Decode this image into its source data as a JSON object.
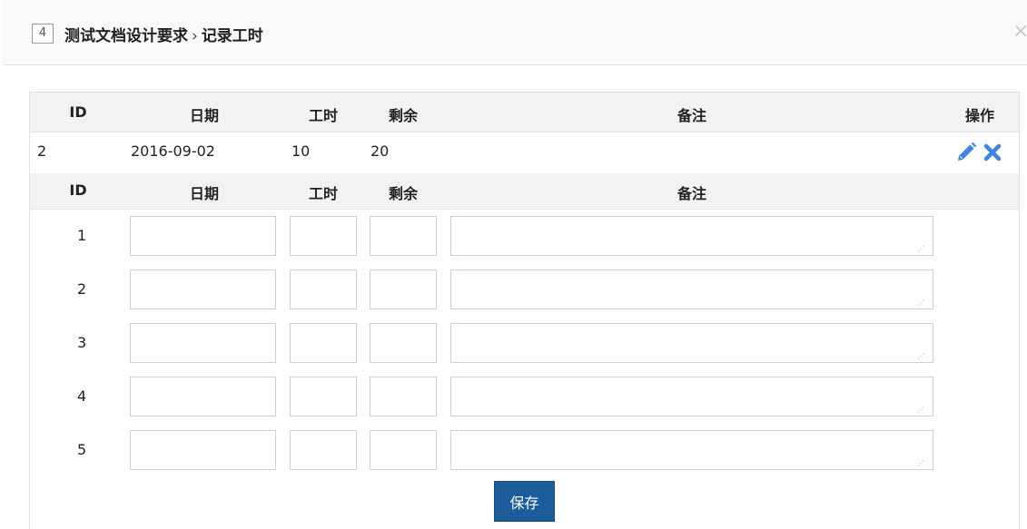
{
  "modal": {
    "id_badge": "4",
    "title_part1": "测试文档设计要求",
    "separator": "›",
    "title_part2": "记录工时",
    "close_glyph": "×"
  },
  "columns": {
    "id": "ID",
    "date": "日期",
    "hours": "工时",
    "remaining": "剩余",
    "note": "备注",
    "actions": "操作"
  },
  "records": [
    {
      "id": "2",
      "date": "2016-09-02",
      "hours": "10",
      "remaining": "20",
      "note": ""
    }
  ],
  "row_icons": {
    "edit": "pencil-icon",
    "delete": "close-x-icon"
  },
  "input_rows": [
    {
      "no": "1"
    },
    {
      "no": "2"
    },
    {
      "no": "3"
    },
    {
      "no": "4"
    },
    {
      "no": "5"
    }
  ],
  "save_label": "保存",
  "colors": {
    "header_bg": "#f2f2f2",
    "icon_blue": "#3f86e0",
    "save_bg": "#1d5c9b"
  }
}
